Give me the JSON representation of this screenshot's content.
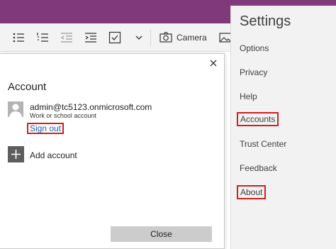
{
  "ribbon": {
    "camera_label": "Camera"
  },
  "dialog": {
    "title": "Account",
    "account_email": "admin@tc5123.onmicrosoft.com",
    "account_type": "Work or school account",
    "sign_out_label": "Sign out",
    "add_account_label": "Add account",
    "close_label": "Close"
  },
  "settings": {
    "title": "Settings",
    "items": [
      {
        "label": "Options"
      },
      {
        "label": "Privacy"
      },
      {
        "label": "Help"
      },
      {
        "label": "Accounts"
      },
      {
        "label": "Trust Center"
      },
      {
        "label": "Feedback"
      },
      {
        "label": "About"
      }
    ]
  },
  "colors": {
    "title_bar": "#80397b",
    "highlight_box": "#d21f1f",
    "link": "#1a5fb4",
    "settings_bg": "#f2f2f2"
  }
}
